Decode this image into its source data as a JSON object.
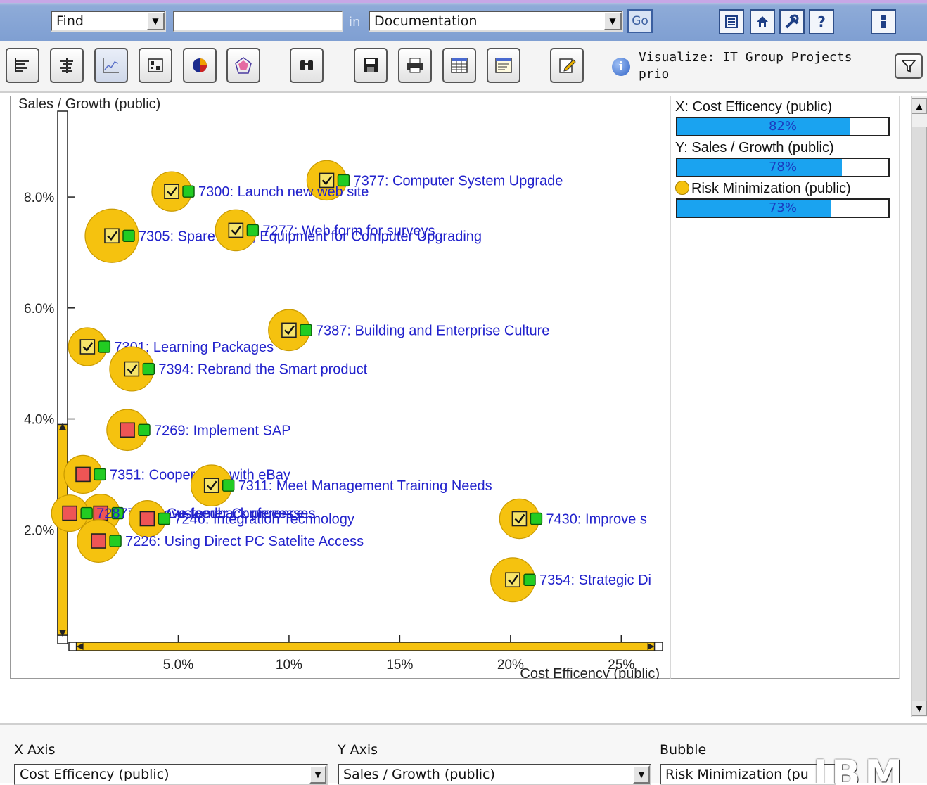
{
  "search": {
    "find_label": "Find",
    "query_value": "",
    "in_label": "in",
    "scope_value": "Documentation",
    "go_label": "Go"
  },
  "nav_icons": [
    "list-icon",
    "home-icon",
    "tools-icon",
    "help-icon",
    "user-icon"
  ],
  "nav_glyphs": {
    "help": "?"
  },
  "toolbar": {
    "visualize_label": "Visualize: IT Group Projects prio",
    "buttons": [
      "bar-chart-icon",
      "gantt-chart-icon",
      "scatter-chart-icon",
      "matrix-chart-icon",
      "pie-chart-icon",
      "radar-chart-icon",
      "binoculars-icon",
      "save-icon",
      "print-icon",
      "table-icon",
      "report-icon",
      "edit-icon"
    ]
  },
  "legend": {
    "x_label": "X: Cost Efficency (public)",
    "x_pct_text": "82%",
    "x_value": 0.82,
    "y_label": "Y: Sales / Growth (public)",
    "y_pct_text": "78%",
    "y_value": 0.78,
    "bubble_label": "Risk Minimization (public)",
    "bubble_pct_text": "73%",
    "bubble_value": 0.73
  },
  "axes_selectors": {
    "x_title": "X Axis",
    "x_value": "Cost Efficency (public)",
    "y_title": "Y Axis",
    "y_value": "Sales / Growth (public)",
    "bubble_title": "Bubble",
    "bubble_value": "Risk Minimization (pu"
  },
  "brand": "IBM",
  "colors": {
    "bubble": "#f5c20f",
    "point_label": "#2222cc",
    "axis_bar": "#f5c20f",
    "legend_fill": "#1aa3f0",
    "status_green": "#22cc22",
    "status_red": "#ee5555"
  },
  "chart_data": {
    "type": "scatter",
    "title": "",
    "xlabel": "Cost Efficency (public)",
    "ylabel": "Sales / Growth (public)",
    "xlim": [
      0,
      26.8
    ],
    "ylim": [
      0,
      9.7
    ],
    "x_ticks": [
      "5.0%",
      "10%",
      "15%",
      "20%",
      "25%"
    ],
    "x_tick_values": [
      5,
      10,
      15,
      20,
      25
    ],
    "y_ticks": [
      "2.0%",
      "4.0%",
      "6.0%",
      "8.0%"
    ],
    "y_tick_values": [
      2,
      4,
      6,
      8
    ],
    "x_range_indicator": [
      0.4,
      26.5
    ],
    "y_range_indicator": [
      0.1,
      3.9
    ],
    "points": [
      {
        "label": "7377: Computer System Upgrade",
        "x": 11.7,
        "y": 8.3,
        "size": 0.55,
        "checked": true
      },
      {
        "label": "7300: Launch new web site",
        "x": 4.7,
        "y": 8.1,
        "size": 0.55,
        "checked": true
      },
      {
        "label": "7305: Spare Parts, Equipment for Computer Upgrading",
        "x": 2.0,
        "y": 7.3,
        "size": 1.0,
        "checked": true
      },
      {
        "label": "7277: Web form for surveys",
        "x": 7.6,
        "y": 7.4,
        "size": 0.6,
        "checked": true
      },
      {
        "label": "7387: Building and Enterprise Culture",
        "x": 10.0,
        "y": 5.6,
        "size": 0.6,
        "checked": true
      },
      {
        "label": "7301: Learning Packages",
        "x": 0.9,
        "y": 5.3,
        "size": 0.5,
        "checked": true
      },
      {
        "label": "7394: Rebrand the Smart product",
        "x": 2.9,
        "y": 4.9,
        "size": 0.7,
        "checked": true
      },
      {
        "label": "7269: Implement SAP",
        "x": 2.7,
        "y": 3.8,
        "size": 0.6,
        "checked": false
      },
      {
        "label": "7351: Cooperation with eBay",
        "x": 0.7,
        "y": 3.0,
        "size": 0.5,
        "checked": false
      },
      {
        "label": "7311: Meet Management Training Needs",
        "x": 6.5,
        "y": 2.8,
        "size": 0.6,
        "checked": true
      },
      {
        "label": "7255: Customer Conference",
        "x": 1.5,
        "y": 2.3,
        "size": 0.5,
        "checked": false
      },
      {
        "label": "7287: Improve feedback processes",
        "x": 0.1,
        "y": 2.3,
        "size": 0.45,
        "checked": false
      },
      {
        "label": "7246: Integration Technology",
        "x": 3.6,
        "y": 2.2,
        "size": 0.45,
        "checked": false
      },
      {
        "label": "7430: Improve s",
        "x": 20.4,
        "y": 2.2,
        "size": 0.55,
        "checked": true
      },
      {
        "label": "7226: Using Direct PC Satelite Access",
        "x": 1.4,
        "y": 1.8,
        "size": 0.65,
        "checked": false
      },
      {
        "label": "7354: Strategic Di",
        "x": 20.1,
        "y": 1.1,
        "size": 0.7,
        "checked": true
      }
    ]
  }
}
